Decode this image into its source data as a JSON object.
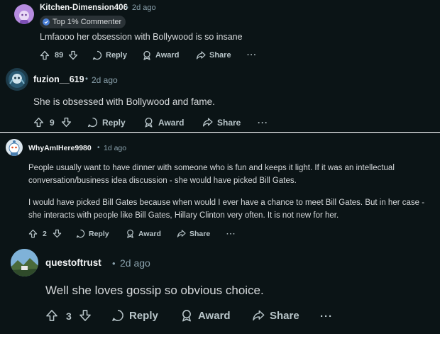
{
  "comments": [
    {
      "username": "Kitchen-Dimension406",
      "time": "2d ago",
      "flair": "Top 1% Commenter",
      "text": "Lmfaooo her obsession with Bollywood is so insane",
      "votes": "89",
      "reply_label": "Reply",
      "award_label": "Award",
      "share_label": "Share",
      "more_label": "···",
      "avatar_color": "#b68ce0"
    },
    {
      "username": "fuzion__619",
      "time": "2d ago",
      "text": "She is obsessed with Bollywood and fame.",
      "votes": "9",
      "reply_label": "Reply",
      "award_label": "Award",
      "share_label": "Share",
      "more_label": "···",
      "avatar_color": "#2a5a73"
    },
    {
      "username": "WhyAmIHere9980",
      "time": "1d ago",
      "paragraph1_line1": "People usually want to have dinner with someone who is fun and keeps it light. If it was an intellectual",
      "paragraph1_line2": "conversation/business idea discussion - she would have picked Bill Gates.",
      "paragraph2_line1": "I would have picked Bill Gates because when would I ever have a chance to meet Bill Gates. But in her case -",
      "paragraph2_line2": "she interacts with people like Bill Gates, Hillary Clinton very often. It is not new for her.",
      "votes": "2",
      "reply_label": "Reply",
      "award_label": "Award",
      "share_label": "Share",
      "more_label": "···",
      "avatar_color": "#4a7fb0"
    },
    {
      "username": "questoftrust",
      "time": "2d ago",
      "text": "Well she loves gossip so obvious choice.",
      "votes": "3",
      "reply_label": "Reply",
      "award_label": "Award",
      "share_label": "Share",
      "more_label": "···",
      "avatar_color": "#5d8fb8"
    }
  ],
  "separator": "•"
}
